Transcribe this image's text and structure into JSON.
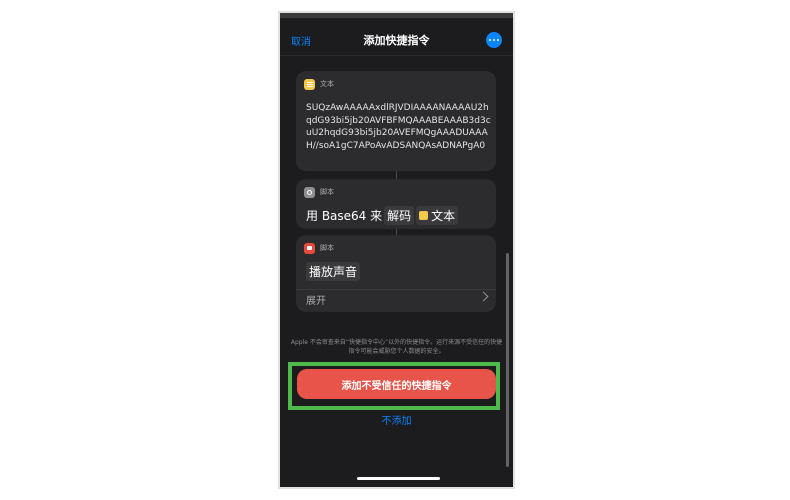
{
  "nav": {
    "cancel": "取消",
    "title": "添加快捷指令",
    "more_icon": "ellipsis-icon"
  },
  "actions": {
    "text": {
      "kind": "文本",
      "icon": "text-app-icon",
      "content": "SUQzAwAAAAAxdlRJVDIAAAANAAAAU2hqdG93bi5jb20AVFBFMQAAABEAAAB3d3cuU2hqdG93bi5jb20AVEFMQgAAADUAAAH//soA1gC7APoAvADSANQAsADNAPgA0"
    },
    "base64": {
      "kind": "脚本",
      "icon": "scripting-app-icon",
      "prefix": "用 Base64 来",
      "mode": "解码",
      "var": "文本"
    },
    "sound": {
      "kind": "脚本",
      "icon": "sound-app-icon",
      "action": "播放声音",
      "expand": "展开"
    }
  },
  "footer": {
    "disclaimer": "Apple 不会审查来自“快捷指令中心”以外的快捷指令。运行来源不受信任的快捷指令可能会威胁您个人数据的安全。",
    "add_button": "添加不受信任的快捷指令",
    "cancel_link": "不添加"
  },
  "colors": {
    "accent": "#0a84ff",
    "danger": "#e8544a",
    "highlight": "#4fb84a"
  }
}
